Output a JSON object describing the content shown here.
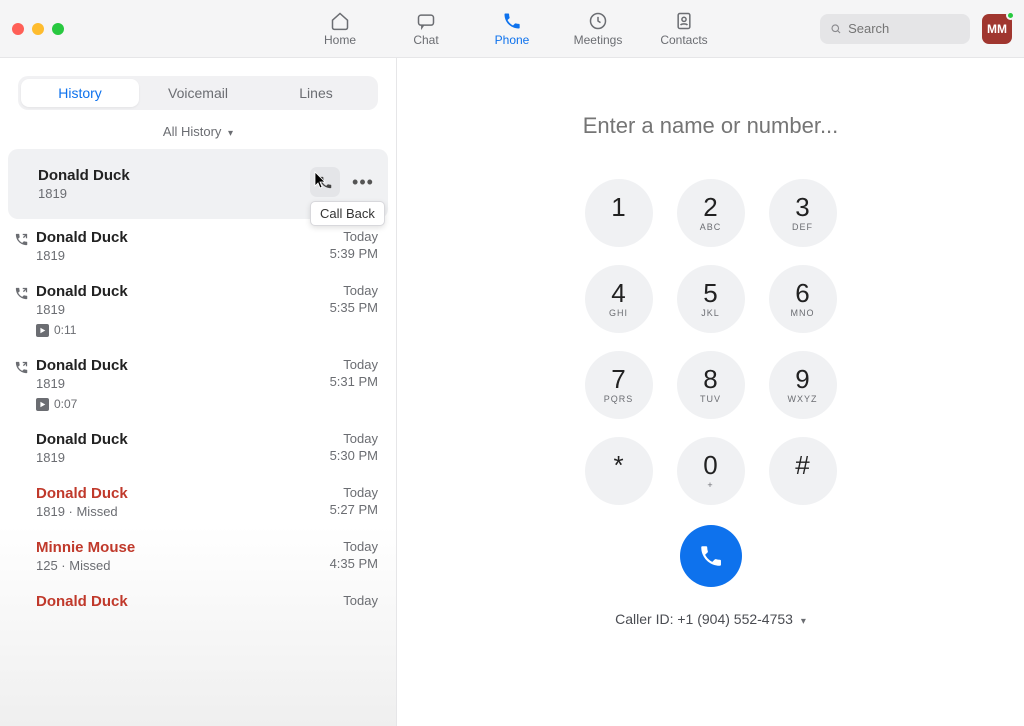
{
  "nav": {
    "items": [
      {
        "id": "home",
        "label": "Home",
        "icon": "home"
      },
      {
        "id": "chat",
        "label": "Chat",
        "icon": "chat"
      },
      {
        "id": "phone",
        "label": "Phone",
        "icon": "phone",
        "active": true
      },
      {
        "id": "meetings",
        "label": "Meetings",
        "icon": "clock"
      },
      {
        "id": "contacts",
        "label": "Contacts",
        "icon": "contacts"
      }
    ],
    "search_placeholder": "Search",
    "avatar_initials": "MM"
  },
  "sidebar": {
    "segments": [
      {
        "label": "History",
        "active": true
      },
      {
        "label": "Voicemail"
      },
      {
        "label": "Lines"
      }
    ],
    "filter_label": "All History",
    "selected_actions": {
      "callback_label": "Call Back"
    },
    "history": [
      {
        "name": "Donald Duck",
        "sub": "1819",
        "selected": true
      },
      {
        "name": "Donald Duck",
        "sub": "1819",
        "day": "Today",
        "time": "5:39 PM",
        "lead": "outgoing"
      },
      {
        "name": "Donald Duck",
        "sub": "1819",
        "day": "Today",
        "time": "5:35 PM",
        "lead": "outgoing",
        "recording": "0:11"
      },
      {
        "name": "Donald Duck",
        "sub": "1819",
        "day": "Today",
        "time": "5:31 PM",
        "lead": "outgoing",
        "recording": "0:07"
      },
      {
        "name": "Donald Duck",
        "sub": "1819",
        "day": "Today",
        "time": "5:30 PM"
      },
      {
        "name": "Donald Duck",
        "sub": "1819 · Missed",
        "day": "Today",
        "time": "5:27 PM",
        "missed": true
      },
      {
        "name": "Minnie Mouse",
        "sub": "125 · Missed",
        "day": "Today",
        "time": "4:35 PM",
        "missed": true
      },
      {
        "name": "Donald Duck",
        "sub": "",
        "day": "Today",
        "time": "",
        "missed": true
      }
    ]
  },
  "dialer": {
    "placeholder": "Enter a name or number...",
    "keys": [
      {
        "n": "1",
        "l": ""
      },
      {
        "n": "2",
        "l": "ABC"
      },
      {
        "n": "3",
        "l": "DEF"
      },
      {
        "n": "4",
        "l": "GHI"
      },
      {
        "n": "5",
        "l": "JKL"
      },
      {
        "n": "6",
        "l": "MNO"
      },
      {
        "n": "7",
        "l": "PQRS"
      },
      {
        "n": "8",
        "l": "TUV"
      },
      {
        "n": "9",
        "l": "WXYZ"
      },
      {
        "n": "*",
        "l": ""
      },
      {
        "n": "0",
        "l": "+"
      },
      {
        "n": "#",
        "l": ""
      }
    ],
    "caller_id_label": "Caller ID: +1 (904) 552-4753"
  }
}
